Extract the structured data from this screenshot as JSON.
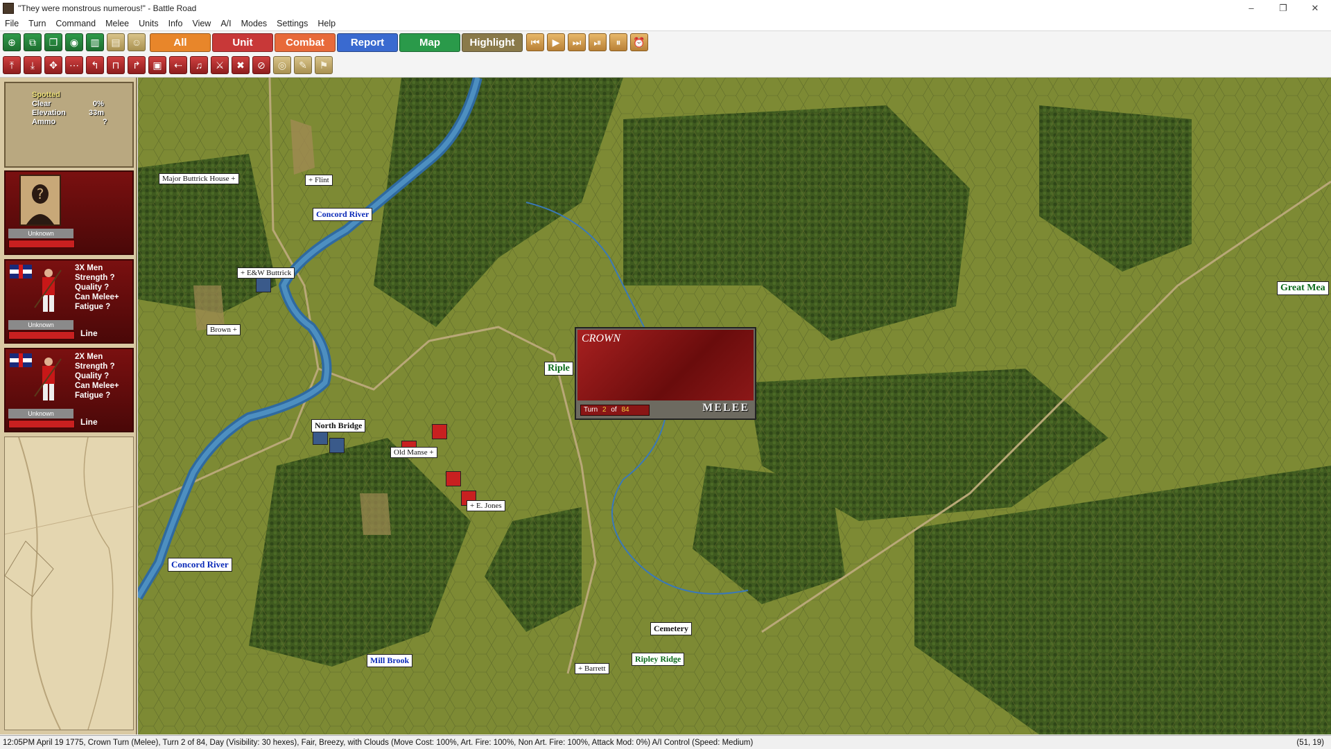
{
  "window": {
    "title": "\"They were monstrous numerous!\" - Battle Road",
    "minimize": "–",
    "maximize": "❐",
    "close": "✕"
  },
  "menu": [
    "File",
    "Turn",
    "Command",
    "Melee",
    "Units",
    "Info",
    "View",
    "A/I",
    "Modes",
    "Settings",
    "Help"
  ],
  "toolbar": {
    "modes": [
      {
        "label": "All",
        "color": "#e8862a"
      },
      {
        "label": "Unit",
        "color": "#c83838"
      },
      {
        "label": "Combat",
        "color": "#e86a3a"
      },
      {
        "label": "Report",
        "color": "#3a6ad0"
      },
      {
        "label": "Map",
        "color": "#2a9a4a"
      },
      {
        "label": "Highlight",
        "color": "#8a7a4a"
      }
    ],
    "playback": [
      "⏮",
      "▶",
      "⏭",
      "⏯",
      "⏸",
      "⏰"
    ]
  },
  "hex_info": {
    "status": "Spotted",
    "terrain": "Clear",
    "terrain_value": "0%",
    "elevation_label": "Elevation",
    "elevation": "33m",
    "ammo_label": "Ammo",
    "ammo": "?"
  },
  "leader": {
    "name": "Unknown"
  },
  "units": [
    {
      "men": "3X Men",
      "strength": "Strength ?",
      "quality": "Quality ?",
      "melee": "Can Melee+",
      "fatigue": "Fatigue ?",
      "name": "Unknown",
      "formation": "Line"
    },
    {
      "men": "2X Men",
      "strength": "Strength ?",
      "quality": "Quality ?",
      "melee": "Can Melee+",
      "fatigue": "Fatigue ?",
      "name": "Unknown",
      "formation": "Line"
    }
  ],
  "map_labels": {
    "major_buttrick": "Major Buttrick House +",
    "flint": "+ Flint",
    "concord_river_top": "Concord River",
    "ew_buttrick": "+ E&W Buttrick",
    "brown": "Brown +",
    "north_bridge": "North Bridge",
    "old_manse": "Old Manse +",
    "e_jones": "+ E. Jones",
    "concord_river_bottom": "Concord River",
    "mill_brook": "Mill Brook",
    "barrett": "+ Barrett",
    "cemetery": "Cemetery",
    "ripley_ridge": "Ripley Ridge",
    "ripley_partial": "Riple",
    "great_meadow": "Great Mea"
  },
  "melee_box": {
    "side": "CROWN",
    "turn_label": "Turn",
    "turn": "2",
    "of_label": "of",
    "turns_total": "84",
    "phase": "MELEE"
  },
  "status": {
    "text": "12:05PM April 19 1775, Crown Turn (Melee), Turn 2 of 84, Day (Visibility: 30 hexes), Fair, Breezy, with Clouds (Move Cost: 100%, Art. Fire: 100%, Non Art. Fire: 100%, Attack Mod: 0%) A/I Control (Speed: Medium)",
    "coords": "(51, 19)"
  }
}
